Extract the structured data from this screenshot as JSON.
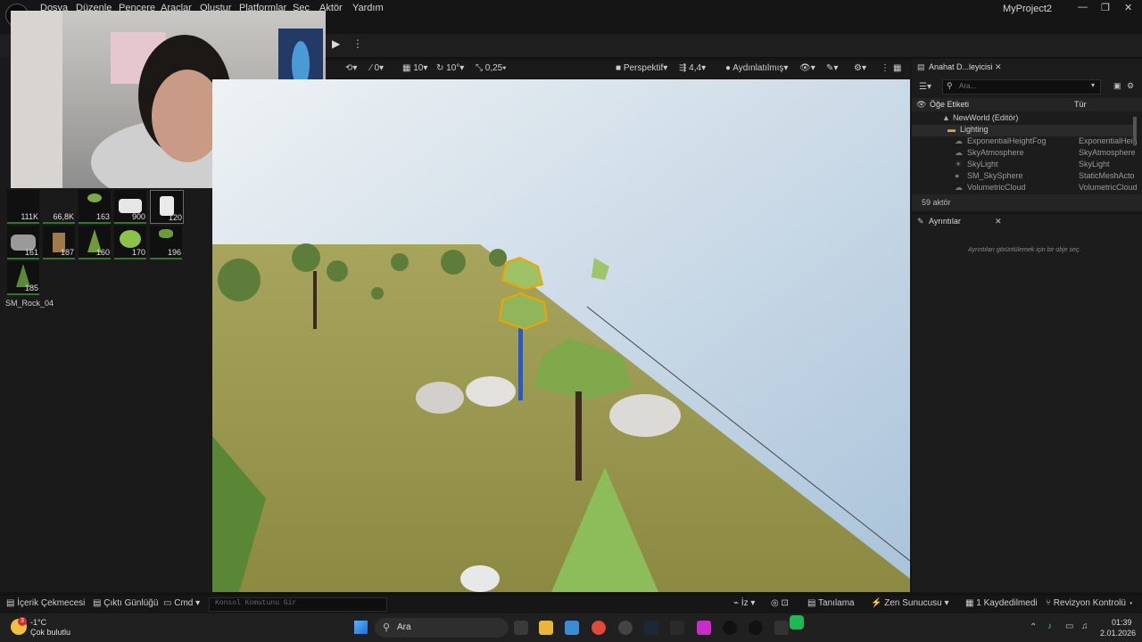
{
  "menubar": {
    "items": [
      "Dosya",
      "Düzenle",
      "Pencere",
      "Araçlar",
      "Oluştur",
      "Platformlar",
      "Seç",
      "Aktör",
      "Yardım"
    ],
    "project": "MyProject2"
  },
  "content_browser": {
    "tiles": [
      {
        "count": "111K",
        "icon": "dark-mesh-icon"
      },
      {
        "count": "66,8K",
        "icon": "dark-mesh-icon"
      },
      {
        "count": "163",
        "icon": "small-tree-icon"
      },
      {
        "count": "900",
        "icon": "white-rock-icon"
      },
      {
        "count": "120",
        "icon": "white-rock-icon"
      },
      {
        "count": "161",
        "icon": "grey-rock-icon"
      },
      {
        "count": "187",
        "icon": "stump-icon"
      },
      {
        "count": "160",
        "icon": "pine-tree-icon"
      },
      {
        "count": "170",
        "icon": "bush-icon"
      },
      {
        "count": "196",
        "icon": "thin-tree-icon"
      },
      {
        "count": "185",
        "icon": "pine-tree-icon"
      }
    ],
    "selected_asset": "SM_Rock_04"
  },
  "viewport_toolbar": {
    "grid_rotation": "0",
    "grid_snap": "10",
    "rotation_snap": "10°",
    "scale_snap": "0,25",
    "view_mode": "Perspektif",
    "camera_speed": "4,4",
    "lighting": "Aydınlatılmış"
  },
  "outliner": {
    "tab_title": "Anahat D...leyicisi",
    "search_placeholder": "Ara...",
    "col_label": "Öğe Etiketi",
    "col_type": "Tür",
    "world": "NewWorld (Editör)",
    "folder": "Lighting",
    "rows": [
      {
        "name": "ExponentialHeightFog",
        "type": "ExponentialHeig"
      },
      {
        "name": "SkyAtmosphere",
        "type": "SkyAtmosphere"
      },
      {
        "name": "SkyLight",
        "type": "SkyLight"
      },
      {
        "name": "SM_SkySphere",
        "type": "StaticMeshActo"
      },
      {
        "name": "VolumetricCloud",
        "type": "VolumetricCloud"
      }
    ],
    "actor_count": "59 aktör"
  },
  "details": {
    "tab_title": "Ayrıntılar",
    "empty_msg": "Ayrıntıları görüntülemek için bir obje seç."
  },
  "statusbar": {
    "content_drawer": "İçerik Çekmecesi",
    "output_log": "Çıktı Günlüğü",
    "cmd": "Cmd",
    "console_placeholder": "Konsol Komutunu Gir",
    "trace": "İz",
    "diagnostics": "Tanılama",
    "zen": "Zen Sunucusu",
    "unsaved": "1 Kaydedilmedi",
    "revision": "Revizyon Kontrolü"
  },
  "taskbar": {
    "temperature": "-1°C",
    "weather": "Çok bulutlu",
    "search": "Ara",
    "time": "01:39",
    "date": "2.01.2026",
    "badge": "3"
  },
  "colors": {
    "accent": "#2b7a2b",
    "selection": "#f0a500"
  }
}
